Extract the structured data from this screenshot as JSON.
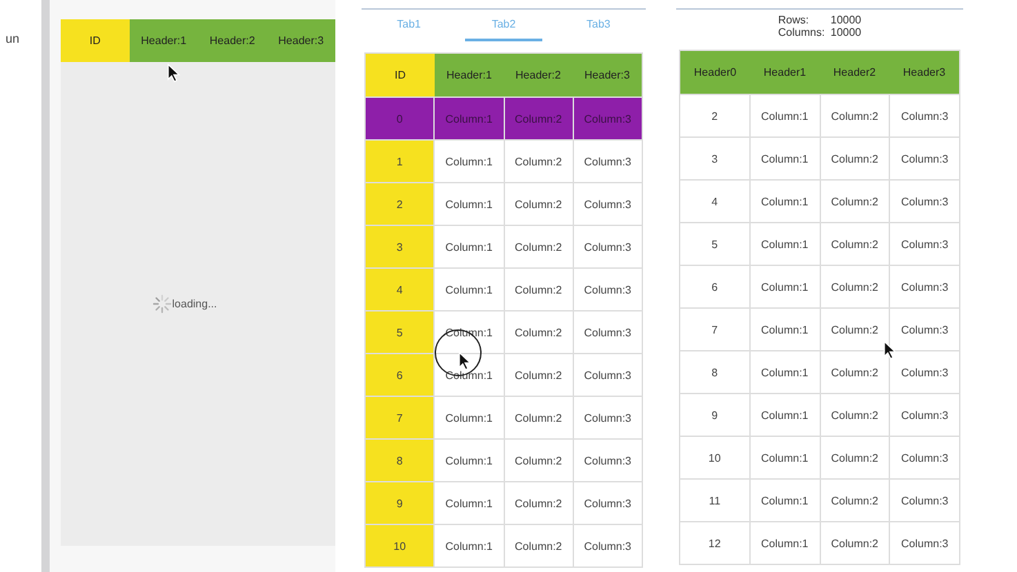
{
  "edge_text": "un",
  "panels": [
    {
      "kind": "loading",
      "columns": [
        "ID",
        "Header:1",
        "Header:2",
        "Header:3"
      ],
      "loading_text": "loading..."
    },
    {
      "kind": "tabs",
      "tabs": [
        {
          "label": "Tab1",
          "selected": false
        },
        {
          "label": "Tab2",
          "selected": true
        },
        {
          "label": "Tab3",
          "selected": false
        }
      ],
      "columns": [
        "ID",
        "Header:1",
        "Header:2",
        "Header:3"
      ],
      "rows": [
        {
          "cells": [
            "0",
            "Column:1",
            "Column:2",
            "Column:3"
          ],
          "selected": true
        },
        {
          "cells": [
            "1",
            "Column:1",
            "Column:2",
            "Column:3"
          ],
          "selected": false
        },
        {
          "cells": [
            "2",
            "Column:1",
            "Column:2",
            "Column:3"
          ],
          "selected": false
        },
        {
          "cells": [
            "3",
            "Column:1",
            "Column:2",
            "Column:3"
          ],
          "selected": false
        },
        {
          "cells": [
            "4",
            "Column:1",
            "Column:2",
            "Column:3"
          ],
          "selected": false
        },
        {
          "cells": [
            "5",
            "Column:1",
            "Column:2",
            "Column:3"
          ],
          "selected": false
        },
        {
          "cells": [
            "6",
            "Column:1",
            "Column:2",
            "Column:3"
          ],
          "selected": false
        },
        {
          "cells": [
            "7",
            "Column:1",
            "Column:2",
            "Column:3"
          ],
          "selected": false
        },
        {
          "cells": [
            "8",
            "Column:1",
            "Column:2",
            "Column:3"
          ],
          "selected": false
        },
        {
          "cells": [
            "9",
            "Column:1",
            "Column:2",
            "Column:3"
          ],
          "selected": false
        },
        {
          "cells": [
            "10",
            "Column:1",
            "Column:2",
            "Column:3"
          ],
          "selected": false
        }
      ]
    },
    {
      "kind": "stats",
      "stats": [
        {
          "label": "Rows:",
          "value": "10000"
        },
        {
          "label": "Columns:",
          "value": "10000"
        }
      ],
      "columns": [
        "Header0",
        "Header1",
        "Header2",
        "Header3"
      ],
      "rows": [
        {
          "cells": [
            "2",
            "Column:1",
            "Column:2",
            "Column:3"
          ],
          "selected": false
        },
        {
          "cells": [
            "3",
            "Column:1",
            "Column:2",
            "Column:3"
          ],
          "selected": false
        },
        {
          "cells": [
            "4",
            "Column:1",
            "Column:2",
            "Column:3"
          ],
          "selected": false
        },
        {
          "cells": [
            "5",
            "Column:1",
            "Column:2",
            "Column:3"
          ],
          "selected": false
        },
        {
          "cells": [
            "6",
            "Column:1",
            "Column:2",
            "Column:3"
          ],
          "selected": false
        },
        {
          "cells": [
            "7",
            "Column:1",
            "Column:2",
            "Column:3"
          ],
          "selected": false
        },
        {
          "cells": [
            "8",
            "Column:1",
            "Column:2",
            "Column:3"
          ],
          "selected": false
        },
        {
          "cells": [
            "9",
            "Column:1",
            "Column:2",
            "Column:3"
          ],
          "selected": false
        },
        {
          "cells": [
            "10",
            "Column:1",
            "Column:2",
            "Column:3"
          ],
          "selected": false
        },
        {
          "cells": [
            "11",
            "Column:1",
            "Column:2",
            "Column:3"
          ],
          "selected": false
        },
        {
          "cells": [
            "12",
            "Column:1",
            "Column:2",
            "Column:3"
          ],
          "selected": false
        }
      ]
    }
  ]
}
